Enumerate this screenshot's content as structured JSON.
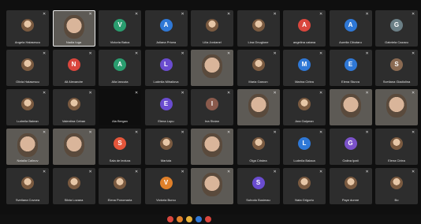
{
  "participants": [
    {
      "name": "Angela Halasescu",
      "kind": "photo"
    },
    {
      "name": "Nadia Iuga",
      "kind": "video",
      "speaking": true
    },
    {
      "name": "Victoria Batca",
      "initial": "V",
      "color": "#2a9d6f"
    },
    {
      "name": "Juliana Pricea",
      "initial": "A",
      "color": "#2f78d6"
    },
    {
      "name": "Lilia Jordanel",
      "kind": "photo"
    },
    {
      "name": "Lina Onuglone",
      "kind": "photo"
    },
    {
      "name": "angelina catana",
      "initial": "A",
      "color": "#d9463d"
    },
    {
      "name": "Aurelia Cibotaru",
      "initial": "A",
      "color": "#2f78d6"
    },
    {
      "name": "Gabriela Cazacu",
      "initial": "G",
      "color": "#6b7f86"
    },
    {
      "name": "Olivia Halasescu",
      "kind": "photo"
    },
    {
      "name": "Ali Alexandre",
      "initial": "N",
      "color": "#d9463d"
    },
    {
      "name": "Alla Iancuta",
      "initial": "A",
      "color": "#2a9d6f"
    },
    {
      "name": "Ludmila Mihailova",
      "initial": "L",
      "color": "#6a4ccf"
    },
    {
      "name": "",
      "kind": "video"
    },
    {
      "name": "Maria Garcon",
      "kind": "photo"
    },
    {
      "name": "Marina Cirlea",
      "initial": "M",
      "color": "#2f78d6"
    },
    {
      "name": "Elena Sturza",
      "initial": "E",
      "color": "#2f78d6"
    },
    {
      "name": "Svetlana Gladiolina",
      "initial": "S",
      "color": "#8a6a52"
    },
    {
      "name": "Ludmila Balean",
      "kind": "photo"
    },
    {
      "name": "Valentina Ceban",
      "kind": "photo"
    },
    {
      "name": "Ala Bergan",
      "kind": "dark"
    },
    {
      "name": "Elena Lupu",
      "initial": "E",
      "color": "#6a4ccf"
    },
    {
      "name": "Ina Stoian",
      "initial": "I",
      "color": "#8a5a4c"
    },
    {
      "name": "",
      "kind": "video"
    },
    {
      "name": "Ana Galpean",
      "kind": "photo"
    },
    {
      "name": "",
      "kind": "video"
    },
    {
      "name": "",
      "kind": "video"
    },
    {
      "name": "Natalia Calinov",
      "kind": "video"
    },
    {
      "name": "",
      "kind": "video"
    },
    {
      "name": "Sala de lectura",
      "initial": "S",
      "color": "#e4563b"
    },
    {
      "name": "Mariuta",
      "kind": "photo"
    },
    {
      "name": "",
      "kind": "video"
    },
    {
      "name": "Olga Cristea",
      "kind": "photo"
    },
    {
      "name": "Ludmila Balaca",
      "initial": "L",
      "color": "#2f78d6"
    },
    {
      "name": "Galina Ipati",
      "initial": "G",
      "color": "#7b52c9"
    },
    {
      "name": "Elena Cirlea",
      "kind": "photo"
    },
    {
      "name": "Svetlana Covcea",
      "kind": "photo"
    },
    {
      "name": "Silvia Lozana",
      "kind": "photo"
    },
    {
      "name": "Elena Ponomaria",
      "kind": "photo"
    },
    {
      "name": "Victoria Burcu",
      "initial": "V",
      "color": "#e0802a"
    },
    {
      "name": "",
      "kind": "video"
    },
    {
      "name": "Suhodu Busimau",
      "initial": "S",
      "color": "#6a4ccf"
    },
    {
      "name": "Nata Grigoriu",
      "kind": "photo"
    },
    {
      "name": "Paye dunne",
      "kind": "photo"
    },
    {
      "name": "Bo",
      "kind": "photo"
    }
  ],
  "bottom_bar": {
    "colors": [
      "#d9463d",
      "#e0802a",
      "#e8b23a",
      "#2f78d6",
      "#d9463d"
    ]
  }
}
